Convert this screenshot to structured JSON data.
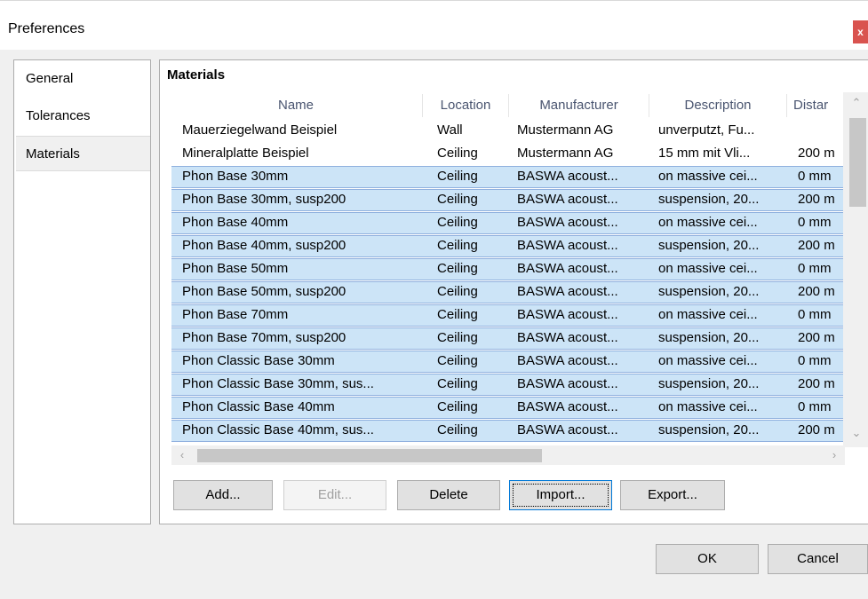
{
  "window": {
    "title": "Preferences",
    "close_label": "x",
    "close_color": "#d9534f"
  },
  "nav": {
    "items": [
      {
        "label": "General",
        "selected": false
      },
      {
        "label": "Tolerances",
        "selected": false
      },
      {
        "label": "Materials",
        "selected": true
      }
    ]
  },
  "materials": {
    "section_title": "Materials",
    "columns": [
      "Name",
      "Location",
      "Manufacturer",
      "Description",
      "Distar"
    ],
    "rows": [
      {
        "name": "Mauerziegelwand Beispiel",
        "location": "Wall",
        "manufacturer": "Mustermann AG",
        "description": "unverputzt, Fu...",
        "distance": "",
        "selected": false
      },
      {
        "name": "Mineralplatte Beispiel",
        "location": "Ceiling",
        "manufacturer": "Mustermann AG",
        "description": "15 mm mit Vli...",
        "distance": "200 m",
        "selected": false
      },
      {
        "name": "Phon Base 30mm",
        "location": "Ceiling",
        "manufacturer": "BASWA acoust...",
        "description": "on massive cei...",
        "distance": "0 mm",
        "selected": true
      },
      {
        "name": "Phon Base 30mm, susp200",
        "location": "Ceiling",
        "manufacturer": "BASWA acoust...",
        "description": "suspension, 20...",
        "distance": "200 m",
        "selected": true
      },
      {
        "name": "Phon Base 40mm",
        "location": "Ceiling",
        "manufacturer": "BASWA acoust...",
        "description": "on massive cei...",
        "distance": "0 mm",
        "selected": true
      },
      {
        "name": "Phon Base 40mm, susp200",
        "location": "Ceiling",
        "manufacturer": "BASWA acoust...",
        "description": "suspension, 20...",
        "distance": "200 m",
        "selected": true
      },
      {
        "name": "Phon Base 50mm",
        "location": "Ceiling",
        "manufacturer": "BASWA acoust...",
        "description": "on massive cei...",
        "distance": "0 mm",
        "selected": true
      },
      {
        "name": "Phon Base 50mm, susp200",
        "location": "Ceiling",
        "manufacturer": "BASWA acoust...",
        "description": "suspension, 20...",
        "distance": "200 m",
        "selected": true
      },
      {
        "name": "Phon Base 70mm",
        "location": "Ceiling",
        "manufacturer": "BASWA acoust...",
        "description": "on massive cei...",
        "distance": "0 mm",
        "selected": true
      },
      {
        "name": "Phon Base 70mm, susp200",
        "location": "Ceiling",
        "manufacturer": "BASWA acoust...",
        "description": "suspension, 20...",
        "distance": "200 m",
        "selected": true
      },
      {
        "name": "Phon Classic Base 30mm",
        "location": "Ceiling",
        "manufacturer": "BASWA acoust...",
        "description": "on massive cei...",
        "distance": "0 mm",
        "selected": true
      },
      {
        "name": "Phon Classic Base 30mm, sus...",
        "location": "Ceiling",
        "manufacturer": "BASWA acoust...",
        "description": "suspension, 20...",
        "distance": "200 m",
        "selected": true
      },
      {
        "name": "Phon Classic Base 40mm",
        "location": "Ceiling",
        "manufacturer": "BASWA acoust...",
        "description": "on massive cei...",
        "distance": "0 mm",
        "selected": true
      },
      {
        "name": "Phon Classic Base 40mm, sus...",
        "location": "Ceiling",
        "manufacturer": "BASWA acoust...",
        "description": "suspension, 20...",
        "distance": "200 m",
        "selected": true
      }
    ],
    "buttons": {
      "add": "Add...",
      "edit": "Edit...",
      "delete": "Delete",
      "import": "Import...",
      "export": "Export..."
    }
  },
  "footer": {
    "ok": "OK",
    "cancel": "Cancel"
  },
  "icons": {
    "scroll_up": "up-arrow-icon",
    "scroll_down": "down-arrow-icon",
    "scroll_left": "left-arrow-icon",
    "scroll_right": "right-arrow-icon"
  },
  "colors": {
    "selection_fill": "#cce4f7",
    "selection_border": "#8fb0de"
  }
}
